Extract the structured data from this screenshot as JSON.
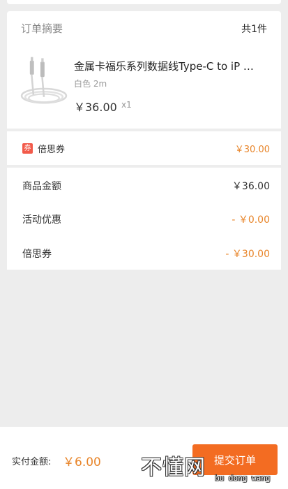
{
  "order_summary": {
    "title": "订单摘要",
    "count": "共1件"
  },
  "product": {
    "name": "金属卡福乐系列数据线Type-C to iP …",
    "spec": "白色 2m",
    "price": "￥36.00",
    "qty": "x1"
  },
  "coupon": {
    "tag": "券",
    "label": "倍思券",
    "value": "￥30.00"
  },
  "amounts": [
    {
      "label": "商品金额",
      "value": "￥36.00"
    },
    {
      "label": "活动优惠",
      "value": "- ￥0.00"
    },
    {
      "label": "倍思券",
      "value": "- ￥30.00"
    }
  ],
  "footer": {
    "pay_label": "实付金额:",
    "pay_value": "￥6.00",
    "submit_label": "提交订单"
  },
  "watermark": {
    "main": "不懂网",
    "sub": "bu dong wang"
  },
  "colors": {
    "accent": "#e8852a",
    "button": "#f36c22",
    "coupon_tag": "#f25a4a"
  }
}
